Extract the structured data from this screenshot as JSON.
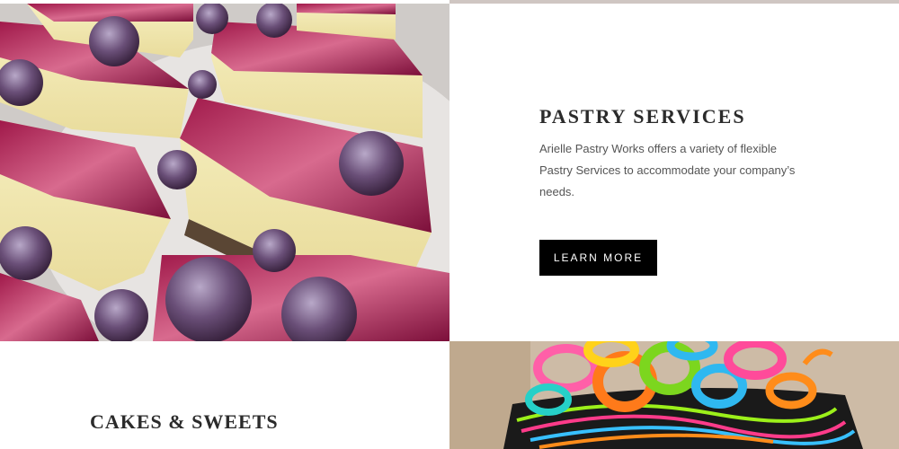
{
  "pastry_services": {
    "title": "PASTRY SERVICES",
    "description": "Arielle Pastry Works offers a variety of flexible Pastry Services to accommodate your company’s needs.",
    "button_label": "LEARN MORE"
  },
  "cakes_sweets": {
    "title": "CAKES & SWEETS"
  },
  "colors": {
    "button_bg": "#000000",
    "button_text": "#ffffff",
    "heading": "#2b2b2b",
    "body_text": "#555555"
  }
}
